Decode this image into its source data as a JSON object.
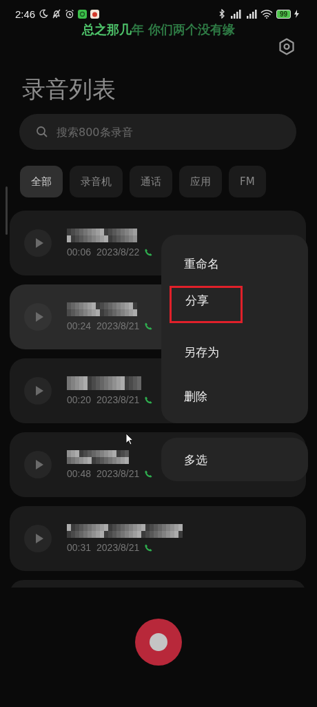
{
  "status_bar": {
    "time": "2:46",
    "battery": "99"
  },
  "lyrics": {
    "sung": "总之那几",
    "unsung": "年 你们两个没有缘"
  },
  "title": "录音列表",
  "search": {
    "placeholder": "搜索800条录音"
  },
  "filters": [
    {
      "label": "全部",
      "selected": true
    },
    {
      "label": "录音机",
      "selected": false
    },
    {
      "label": "通话",
      "selected": false
    },
    {
      "label": "应用",
      "selected": false
    },
    {
      "label": "FM",
      "selected": false
    }
  ],
  "recordings": [
    {
      "duration": "00:06",
      "date": "2023/8/22",
      "kind": "call",
      "selected": false
    },
    {
      "duration": "00:24",
      "date": "2023/8/21",
      "kind": "call",
      "selected": true
    },
    {
      "duration": "00:20",
      "date": "2023/8/21",
      "kind": "call",
      "selected": false
    },
    {
      "duration": "00:48",
      "date": "2023/8/21",
      "kind": "call",
      "selected": false
    },
    {
      "duration": "00:31",
      "date": "2023/8/21",
      "kind": "call",
      "selected": false
    }
  ],
  "context_menu": [
    {
      "label": "重命名",
      "outlined": false
    },
    {
      "label": "分享",
      "outlined": true
    },
    {
      "label": "另存为",
      "outlined": false
    },
    {
      "label": "删除",
      "outlined": false
    }
  ],
  "secondary_menu": [
    {
      "label": "多选"
    }
  ]
}
